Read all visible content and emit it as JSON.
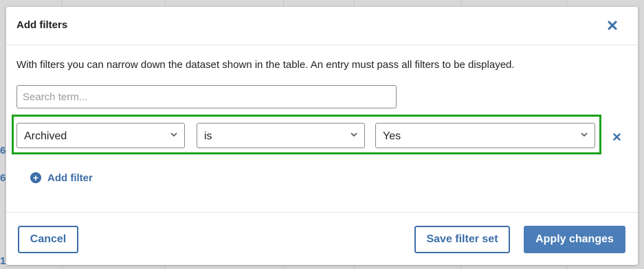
{
  "background": {
    "row_numbers": [
      "6",
      "6",
      "1"
    ]
  },
  "modal": {
    "title": "Add filters",
    "close_icon": "close-icon",
    "description": "With filters you can narrow down the dataset shown in the table. An entry must pass all filters to be displayed.",
    "search": {
      "placeholder": "Search term...",
      "value": ""
    },
    "filters": [
      {
        "field": "Archived",
        "operator": "is",
        "value": "Yes"
      }
    ],
    "add_filter_label": "Add filter",
    "footer": {
      "cancel_label": "Cancel",
      "save_label": "Save filter set",
      "apply_label": "Apply changes"
    }
  },
  "colors": {
    "accent": "#3c6ea8",
    "primary_button": "#4b7db8",
    "highlight_border": "#1aa31a"
  }
}
